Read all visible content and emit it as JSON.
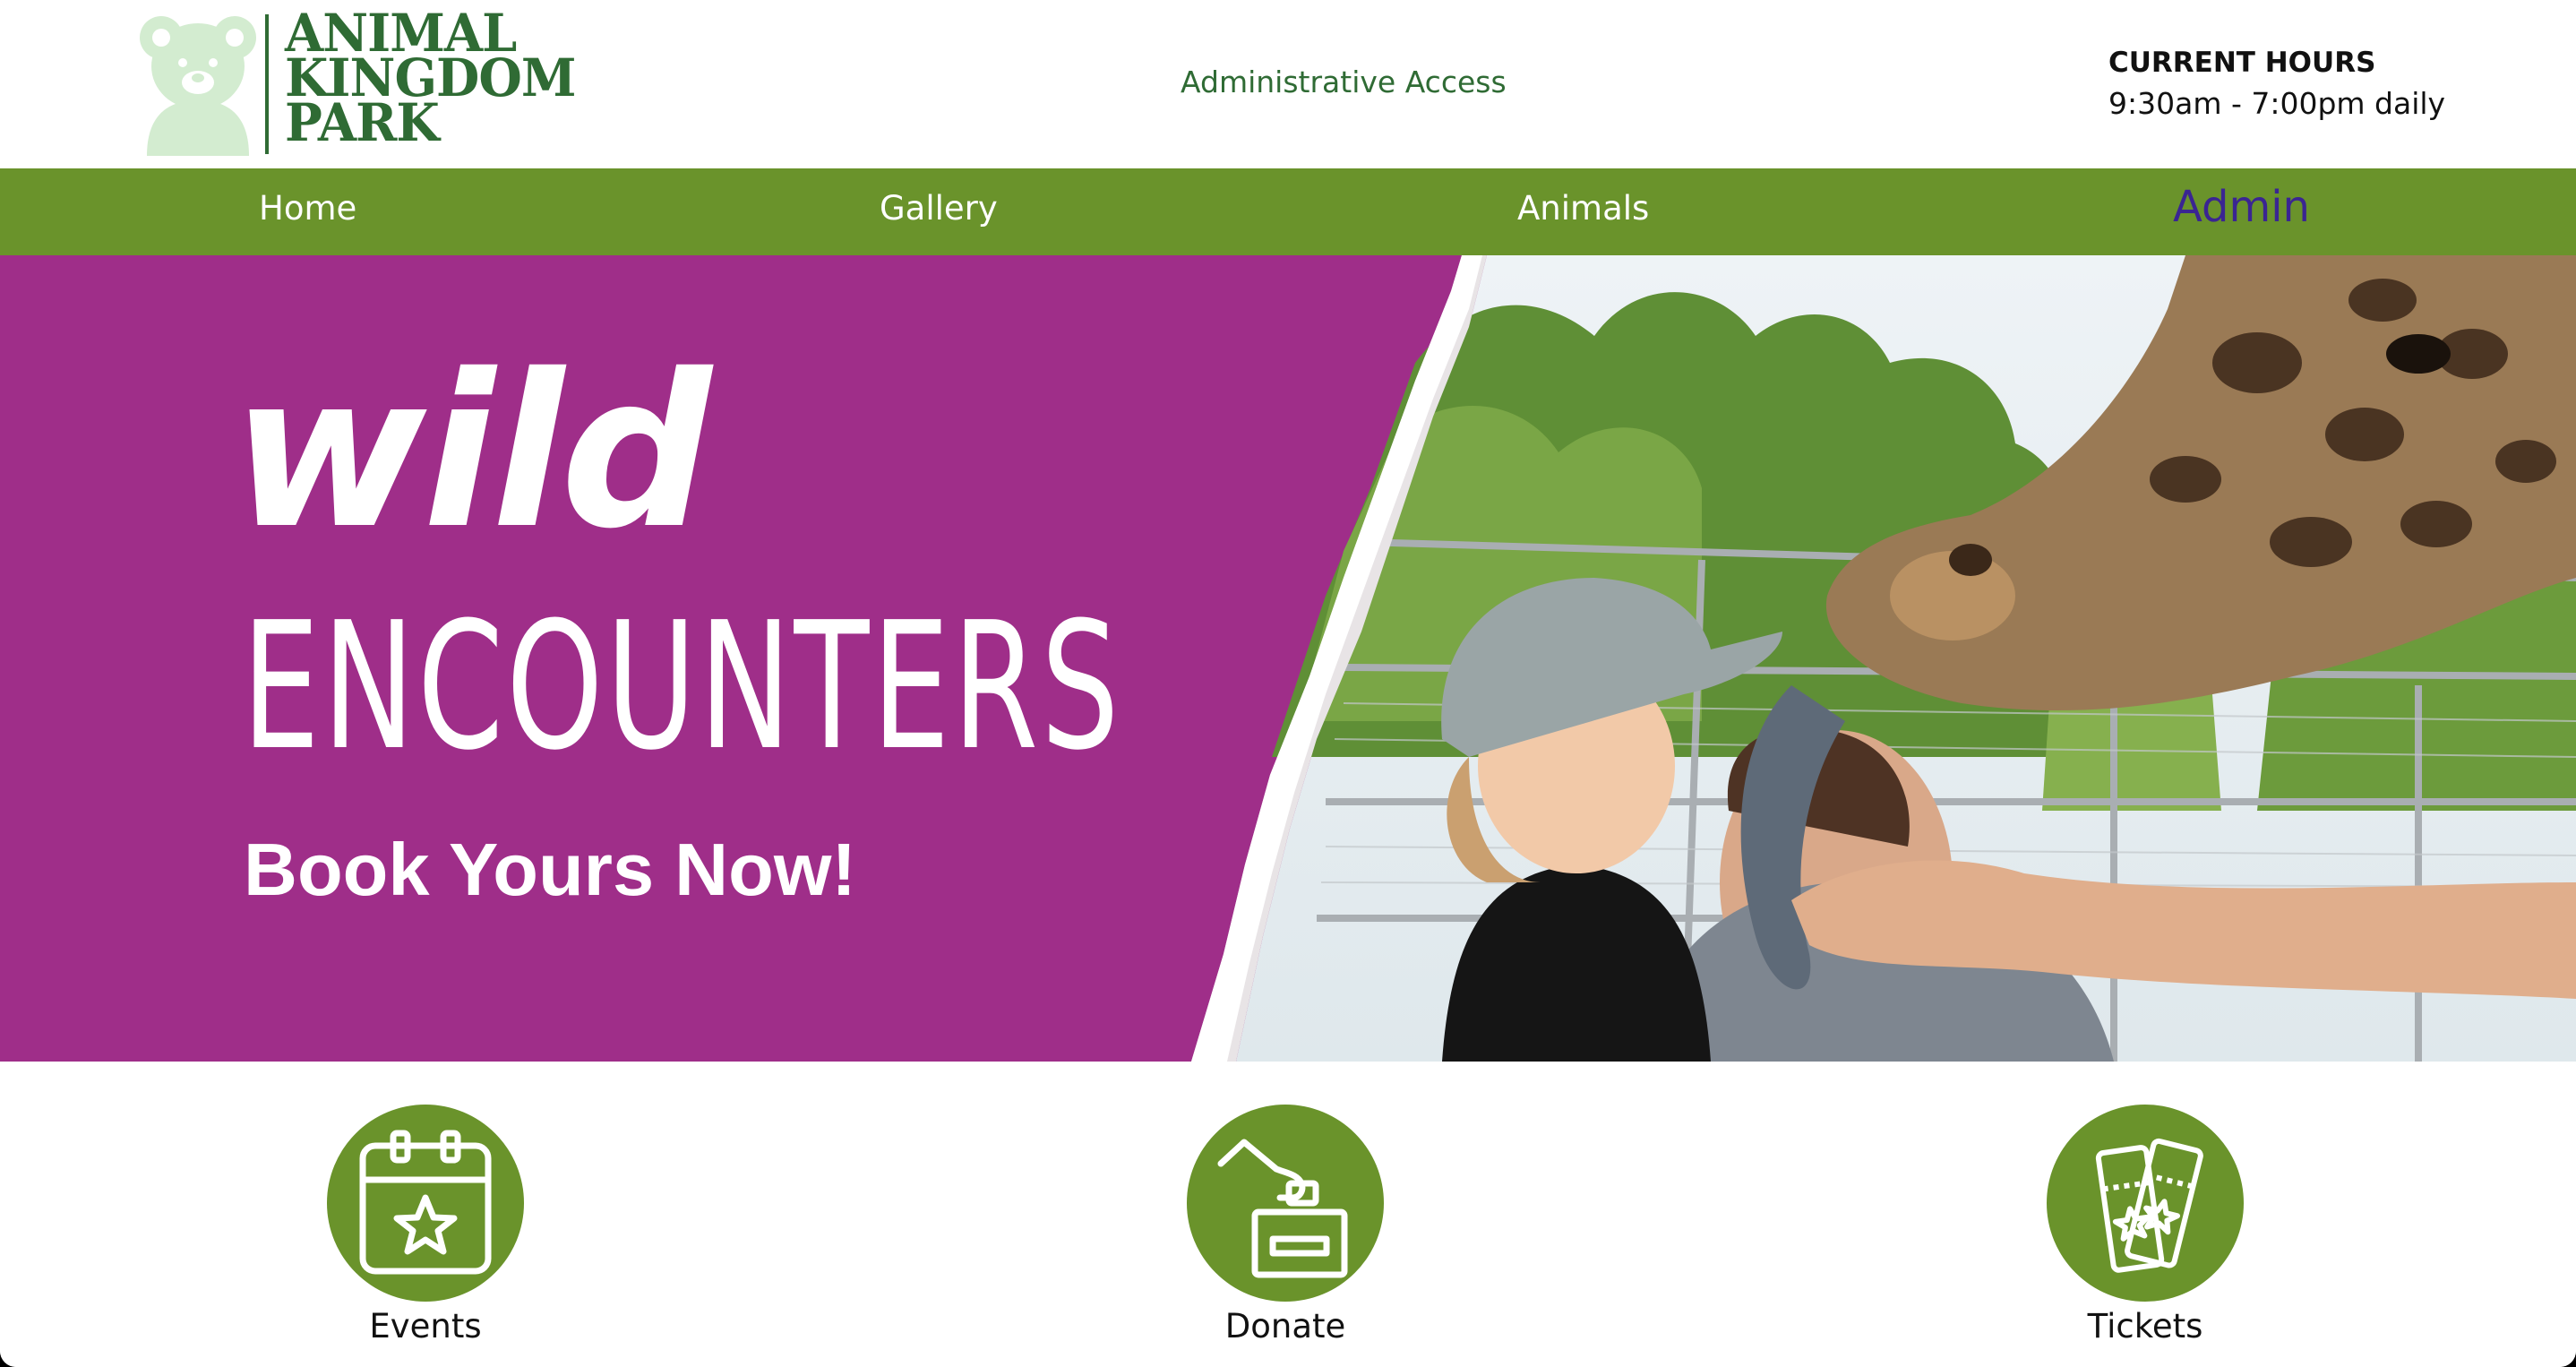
{
  "brand": {
    "logo_lines": [
      "ANIMAL",
      "KINGDOM",
      "PARK"
    ],
    "logo_icon": "bear-icon",
    "primary_green": "#6a932b",
    "dark_green": "#2f6b34",
    "hero_purple": "#9f2e89",
    "active_nav_color": "#3a2592"
  },
  "header": {
    "admin_link": "Administrative Access",
    "hours_title": "CURRENT HOURS",
    "hours_value": "9:30am - 7:00pm daily"
  },
  "nav": {
    "items": [
      {
        "label": "Home",
        "active": false
      },
      {
        "label": "Gallery",
        "active": false
      },
      {
        "label": "Animals",
        "active": false
      },
      {
        "label": "Admin",
        "active": true
      }
    ]
  },
  "hero": {
    "script_text": "wild",
    "headline": "ENCOUNTERS",
    "cta": "Book Yours Now!",
    "photo": "child-and-man-with-giraffe-photo"
  },
  "quick_links": [
    {
      "label": "Events",
      "icon": "calendar-star-icon"
    },
    {
      "label": "Donate",
      "icon": "donate-box-icon"
    },
    {
      "label": "Tickets",
      "icon": "tickets-icon"
    }
  ]
}
